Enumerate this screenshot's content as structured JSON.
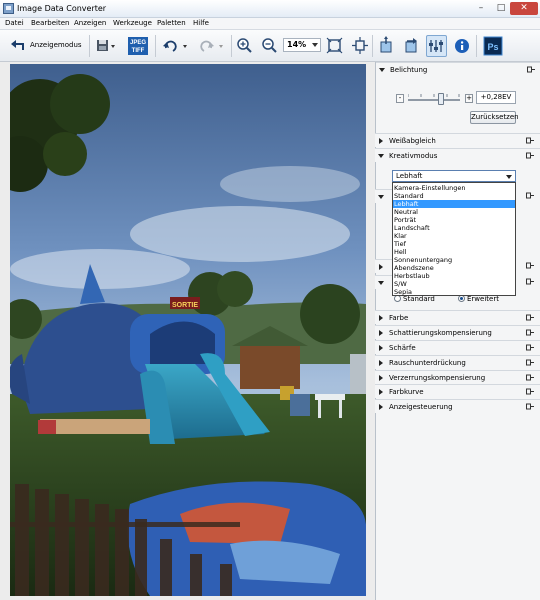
{
  "window": {
    "title": "Image Data Converter",
    "controls": [
      "–",
      "□",
      "✕"
    ]
  },
  "menu": [
    "Datei",
    "Bearbeiten",
    "Anzeigen",
    "Werkzeuge",
    "Paletten",
    "Hilfe"
  ],
  "toolbar": {
    "display_mode_label": "Anzeigemodus",
    "jpeg_label": "JPEG",
    "tiff_label": "TIFF",
    "zoom_value": "14%",
    "ps_label": "Ps"
  },
  "panel": {
    "exposure": {
      "label": "Belichtung",
      "minus": "-",
      "plus": "+",
      "value": "+0,28EV",
      "slider_fraction": 0.64,
      "reset_label": "Zurücksetzen"
    },
    "white_balance": {
      "label": "Weißabgleich"
    },
    "creative": {
      "label": "Kreativmodus",
      "selected": "Lebhaft",
      "options": [
        "Kamera-Einstellungen",
        "Standard",
        "Lebhaft",
        "Neutral",
        "Porträt",
        "Landschaft",
        "Klar",
        "Tief",
        "Hell",
        "Sonnenuntergang",
        "Abendszene",
        "Herbstlaub",
        "S/W",
        "Sepia"
      ]
    },
    "hidden_section_fragment": "F",
    "radio_standard": "Standard",
    "radio_extended": "Erweitert",
    "sections": [
      "Farbe",
      "Schattierungskompensierung",
      "Schärfe",
      "Rauschunterdrückung",
      "Verzerrungskompensierung",
      "Farbkurve",
      "Anzeigesteuerung"
    ]
  },
  "photo": {
    "banner_text": "SORTIE"
  }
}
